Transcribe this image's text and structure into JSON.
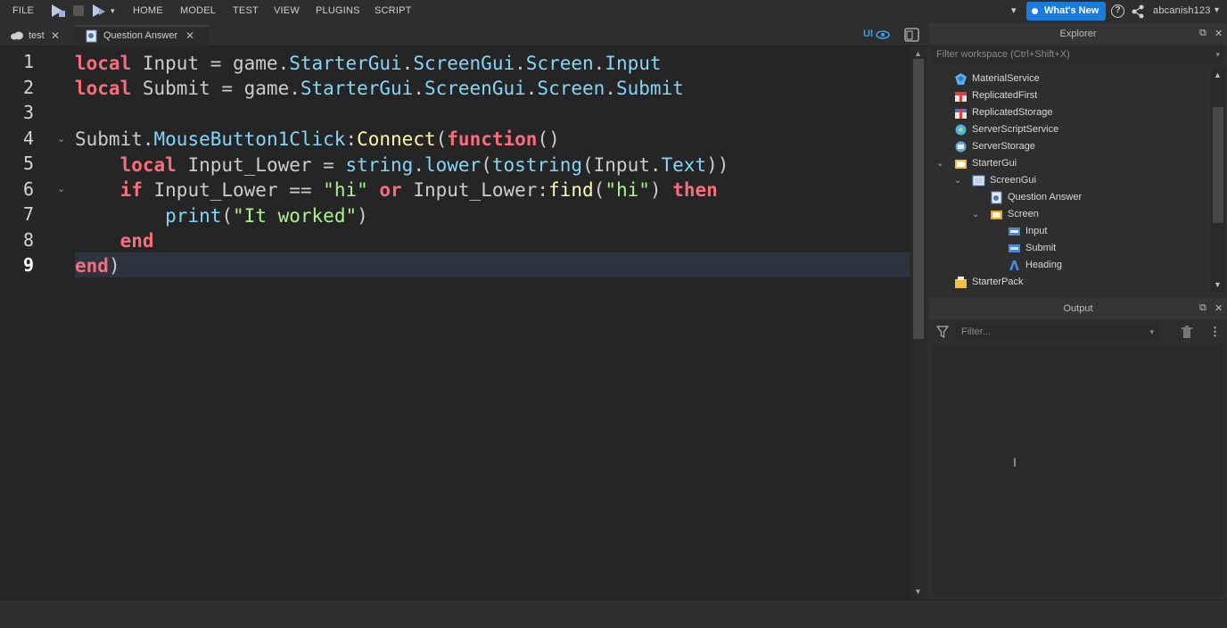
{
  "menubar": {
    "file": "FILE",
    "items": [
      "HOME",
      "MODEL",
      "TEST",
      "VIEW",
      "PLUGINS",
      "SCRIPT"
    ],
    "whats_new": "What's New",
    "username": "abcanish123",
    "help": "?"
  },
  "tabs": [
    {
      "label": "test",
      "active": false
    },
    {
      "label": "Question Answer",
      "active": true
    }
  ],
  "editor": {
    "ui_toggle": "UI",
    "line_numbers": [
      "1",
      "2",
      "3",
      "4",
      "5",
      "6",
      "7",
      "8",
      "9"
    ],
    "current_line": "9",
    "lines": [
      [
        {
          "t": "kw",
          "v": "local"
        },
        {
          "t": "pl",
          "v": " Input = game."
        },
        {
          "t": "pr",
          "v": "StarterGui"
        },
        {
          "t": "pl",
          "v": "."
        },
        {
          "t": "pr",
          "v": "ScreenGui"
        },
        {
          "t": "pl",
          "v": "."
        },
        {
          "t": "pr",
          "v": "Screen"
        },
        {
          "t": "pl",
          "v": "."
        },
        {
          "t": "pr",
          "v": "Input"
        }
      ],
      [
        {
          "t": "kw",
          "v": "local"
        },
        {
          "t": "pl",
          "v": " Submit = game."
        },
        {
          "t": "pr",
          "v": "StarterGui"
        },
        {
          "t": "pl",
          "v": "."
        },
        {
          "t": "pr",
          "v": "ScreenGui"
        },
        {
          "t": "pl",
          "v": "."
        },
        {
          "t": "pr",
          "v": "Screen"
        },
        {
          "t": "pl",
          "v": "."
        },
        {
          "t": "pr",
          "v": "Submit"
        }
      ],
      [],
      [
        {
          "t": "pl",
          "v": "Submit."
        },
        {
          "t": "pr",
          "v": "MouseButton1Click"
        },
        {
          "t": "pl",
          "v": ":"
        },
        {
          "t": "fn",
          "v": "Connect"
        },
        {
          "t": "pl",
          "v": "("
        },
        {
          "t": "kw",
          "v": "function"
        },
        {
          "t": "pl",
          "v": "()"
        }
      ],
      [
        {
          "t": "pl",
          "v": "    "
        },
        {
          "t": "kw",
          "v": "local"
        },
        {
          "t": "pl",
          "v": " Input_Lower = "
        },
        {
          "t": "pr",
          "v": "string"
        },
        {
          "t": "pl",
          "v": "."
        },
        {
          "t": "pr",
          "v": "lower"
        },
        {
          "t": "pl",
          "v": "("
        },
        {
          "t": "pr",
          "v": "tostring"
        },
        {
          "t": "pl",
          "v": "(Input."
        },
        {
          "t": "pr",
          "v": "Text"
        },
        {
          "t": "pl",
          "v": "))"
        }
      ],
      [
        {
          "t": "pl",
          "v": "    "
        },
        {
          "t": "kw",
          "v": "if"
        },
        {
          "t": "pl",
          "v": " Input_Lower == "
        },
        {
          "t": "st",
          "v": "\"hi\""
        },
        {
          "t": "pl",
          "v": " "
        },
        {
          "t": "kw",
          "v": "or"
        },
        {
          "t": "pl",
          "v": " Input_Lower:"
        },
        {
          "t": "fn",
          "v": "find"
        },
        {
          "t": "pl",
          "v": "("
        },
        {
          "t": "st",
          "v": "\"hi\""
        },
        {
          "t": "pl",
          "v": ") "
        },
        {
          "t": "kw",
          "v": "then"
        }
      ],
      [
        {
          "t": "pl",
          "v": "        "
        },
        {
          "t": "pr",
          "v": "print"
        },
        {
          "t": "pl",
          "v": "("
        },
        {
          "t": "st",
          "v": "\"It worked\""
        },
        {
          "t": "pl",
          "v": ")"
        }
      ],
      [
        {
          "t": "pl",
          "v": "    "
        },
        {
          "t": "kw",
          "v": "end"
        }
      ],
      [
        {
          "t": "kw",
          "v": "end"
        },
        {
          "t": "pl",
          "v": ")"
        }
      ]
    ]
  },
  "explorer": {
    "title": "Explorer",
    "filter_placeholder": "Filter workspace (Ctrl+Shift+X)",
    "nodes": [
      {
        "label": "MaterialService",
        "icon": "material-service-icon"
      },
      {
        "label": "ReplicatedFirst",
        "icon": "replicated-first-icon"
      },
      {
        "label": "ReplicatedStorage",
        "icon": "replicated-storage-icon"
      },
      {
        "label": "ServerScriptService",
        "icon": "server-script-service-icon"
      },
      {
        "label": "ServerStorage",
        "icon": "server-storage-icon"
      },
      {
        "label": "StarterGui",
        "icon": "starter-gui-icon"
      },
      {
        "label": "ScreenGui",
        "icon": "screen-gui-icon"
      },
      {
        "label": "Question Answer",
        "icon": "local-script-icon"
      },
      {
        "label": "Screen",
        "icon": "frame-icon"
      },
      {
        "label": "Input",
        "icon": "textbox-icon"
      },
      {
        "label": "Submit",
        "icon": "textbutton-icon"
      },
      {
        "label": "Heading",
        "icon": "textlabel-icon"
      },
      {
        "label": "StarterPack",
        "icon": "starter-pack-icon"
      }
    ]
  },
  "output": {
    "title": "Output",
    "filter_placeholder": "Filter..."
  }
}
